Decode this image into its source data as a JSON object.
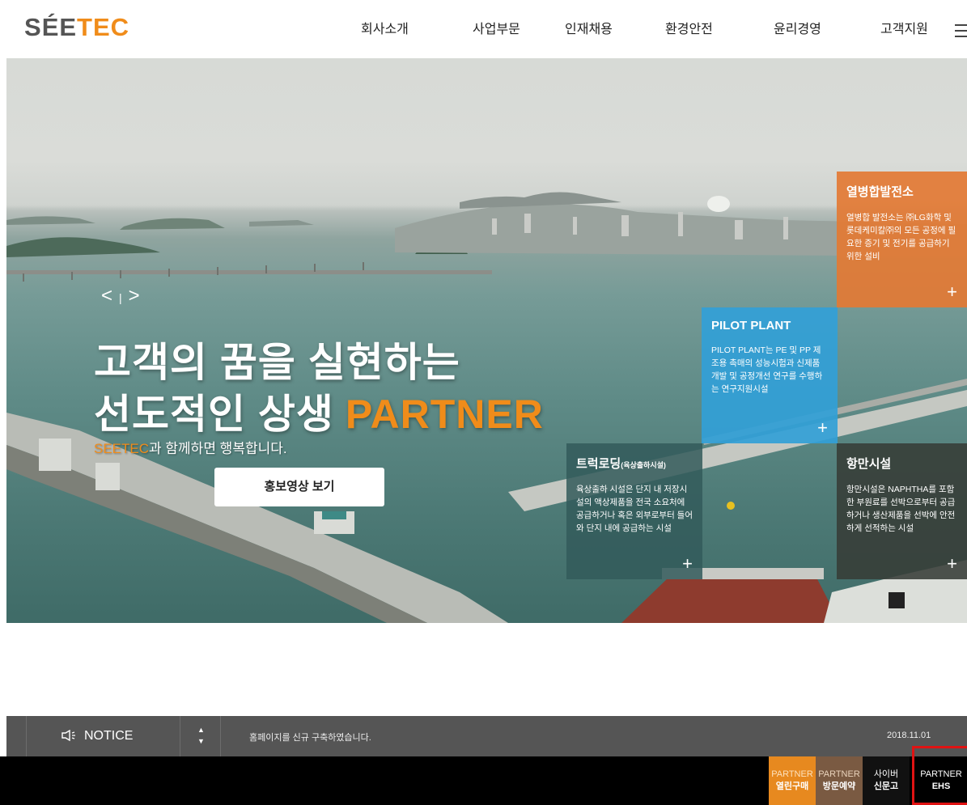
{
  "header": {
    "logo": {
      "s": "S",
      "e": "ÉE",
      "tec": "TEC"
    },
    "nav": [
      {
        "label": "회사소개"
      },
      {
        "label": "사업부문"
      },
      {
        "label": "인재채용"
      },
      {
        "label": "환경안전"
      },
      {
        "label": "윤리경영"
      },
      {
        "label": "고객지원"
      }
    ]
  },
  "hero": {
    "prev_arrow": "<",
    "separator": "|",
    "next_arrow": ">",
    "headline_1": "고객의 꿈을 실현하는",
    "headline_2": "선도적인 상생",
    "headline_accent": "PARTNER",
    "sub_brand": "SEETEC",
    "sub_text": "과 함께하면 행복합니다.",
    "video_button": "홍보영상 보기"
  },
  "boxes": {
    "cogen": {
      "title": "열병합발전소",
      "body": "열병합 발전소는 ㈜LG화학 및 롯데케미칼㈜의 모든 공정에 필요한 증기 및 전기를 공급하기 위한 설비",
      "plus": "+"
    },
    "pilot": {
      "title": "PILOT PLANT",
      "body": "PILOT PLANT는 PE 및 PP 제조용 촉매의 성능시험과 신제품 개발 및 공정개선 연구를 수행하는 연구지원시설",
      "plus": "+"
    },
    "truck": {
      "title": "트럭로딩",
      "title_small": "(육상출하시설)",
      "body": "육상출하 시설은 단지 내 저장시설의 액상제품을 전국 소요처에 공급하거나 혹은 외부로부터 들어와 단지 내에 공급하는 시설",
      "plus": "+"
    },
    "port": {
      "title": "항만시설",
      "body": "항만시설은 NAPHTHA를 포함한 부원료를 선박으로부터 공급하거나 생산제품을 선박에 안전하게 선적하는 시설",
      "plus": "+"
    }
  },
  "notice": {
    "label": "NOTICE",
    "up": "▲",
    "down": "▼",
    "text": "홈페이지를 신규 구축하였습니다.",
    "date": "2018.11.01"
  },
  "footer": {
    "open_purchase": {
      "l1": "PARTNER",
      "l2": "열린구매"
    },
    "visit": {
      "l1": "PARTNER",
      "l2": "방문예약"
    },
    "cyber": {
      "l1": "사이버",
      "l2": "신문고"
    },
    "ehs": {
      "l1": "PARTNER",
      "l2": "EHS"
    }
  },
  "colors": {
    "accent": "#f08c1a",
    "cogen": "#e37a34",
    "pilot": "#32a0d7"
  }
}
